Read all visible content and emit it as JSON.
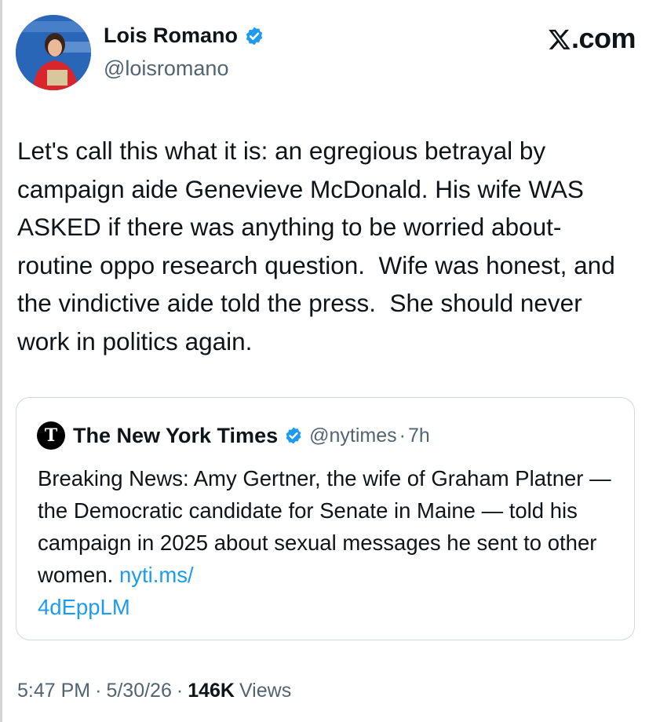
{
  "author": {
    "name": "Lois Romano",
    "handle": "@loisromano"
  },
  "brand": {
    "logo_text": ".com"
  },
  "tweet": {
    "text": "Let's call this what it is: an egregious betrayal by campaign aide Genevieve McDonald. His wife WAS ASKED if there was anything to be worried about- routine oppo research question.  Wife was honest, and the vindictive aide told the press.  She should never work in politics again."
  },
  "quote": {
    "name": "The New York Times",
    "handle": "@nytimes",
    "separator": "·",
    "time": "7h",
    "text": "Breaking News: Amy Gertner, the wife of Graham Platner — the Democratic candidate for Senate in Maine — told his campaign in 2025 about sexual messages he sent to other women. ",
    "link": "nyti.ms/\n4dEppLM",
    "logo_letter": "T"
  },
  "meta": {
    "time": "5:47 PM",
    "date": "5/30/26",
    "separator": "·",
    "views_count": "146K",
    "views_label": "Views"
  },
  "colors": {
    "verified": "#1d9bf0",
    "link": "#1d9bf0",
    "secondary_text": "#536471"
  },
  "icons": {
    "verified": "verified-badge-icon",
    "x_logo": "x-logo-icon",
    "nyt_logo": "nyt-logo-icon"
  }
}
